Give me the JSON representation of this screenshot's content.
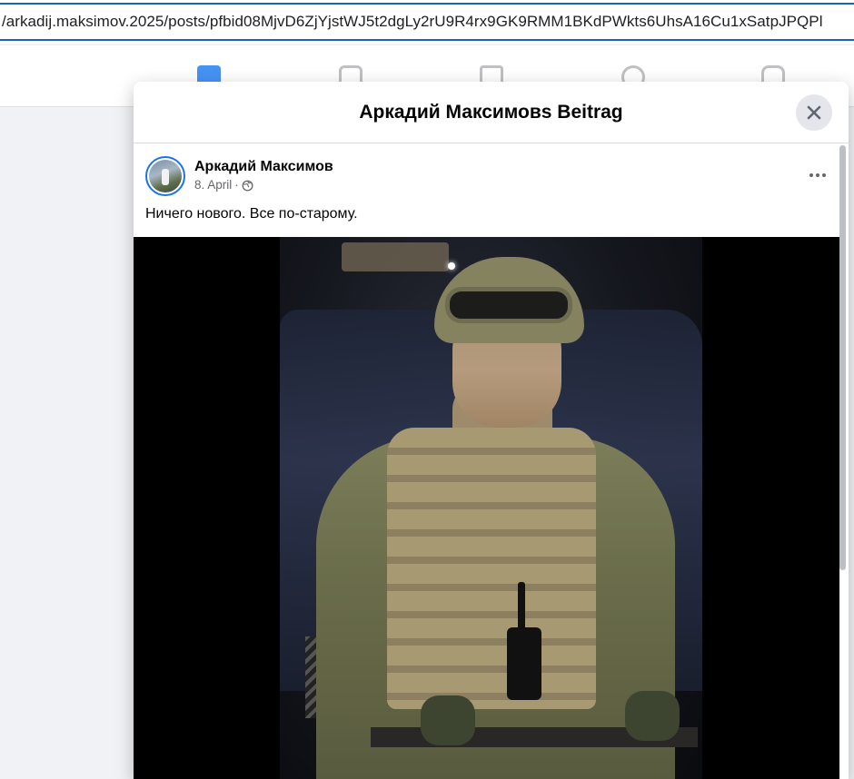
{
  "browser": {
    "url": "/arkadij.maksimov.2025/posts/pfbid08MjvD6ZjYjstWJ5t2dgLy2rU9R4rx9GK9RMM1BKdPWkts6UhsA16Cu1xSatpJPQPl"
  },
  "nav": {
    "icons": [
      "home-icon",
      "video-icon",
      "marketplace-icon",
      "groups-icon",
      "gaming-icon"
    ],
    "active": "home-icon",
    "accent_color": "#1877f2"
  },
  "modal": {
    "title": "Аркадий Максимовs Beitrag",
    "close_icon": "close-icon"
  },
  "post": {
    "author": "Аркадий Максимов",
    "date": "8. April",
    "separator": "·",
    "audience_icon": "globe-icon",
    "text": "Ничего нового. Все по-старому.",
    "more_icon": "more-options-icon"
  }
}
